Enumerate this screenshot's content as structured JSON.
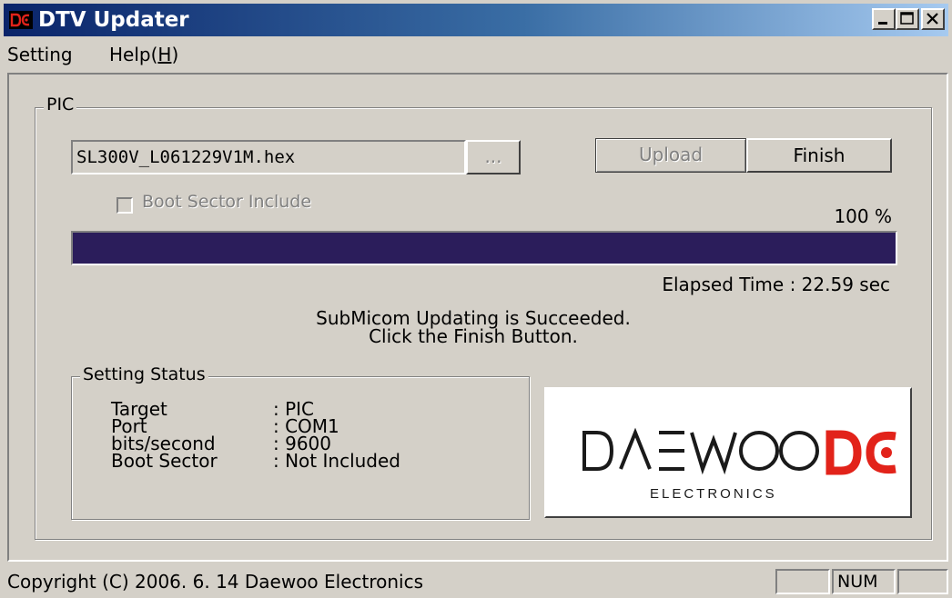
{
  "window": {
    "title": "DTV Updater"
  },
  "menu": {
    "items": [
      {
        "label": "Setting"
      },
      {
        "label_prefix": "Help(",
        "mnemonic": "H",
        "label_suffix": ")"
      }
    ]
  },
  "pic_group": {
    "legend": "PIC",
    "file_path": "SL300V_L061229V1M.hex",
    "browse_label": "...",
    "upload_label": "Upload",
    "finish_label": "Finish",
    "boot_sector_label": "Boot Sector Include",
    "boot_sector_checked": false,
    "progress_percent_text": "100 %",
    "progress_value": 1.0,
    "elapsed_text": "Elapsed Time : 22.59 sec",
    "message_line1": "SubMicom Updating is Succeeded.",
    "message_line2": "Click the Finish Button."
  },
  "setting_status": {
    "legend": "Setting Status",
    "rows": [
      {
        "key": "Target",
        "value": ": PIC"
      },
      {
        "key": "Port",
        "value": ": COM1"
      },
      {
        "key": "bits/second",
        "value": ": 9600"
      },
      {
        "key": "Boot Sector",
        "value": ": Not Included"
      }
    ]
  },
  "logo": {
    "brand": "DAEWOO",
    "sub": "ELECTRONICS"
  },
  "statusbar": {
    "text": "Copyright (C) 2006. 6. 14 Daewoo Electronics",
    "num_indicator": "NUM"
  },
  "colors": {
    "progress_fill": "#2b1d5b",
    "logo_red": "#e2231a",
    "title_start": "#0a246a"
  }
}
